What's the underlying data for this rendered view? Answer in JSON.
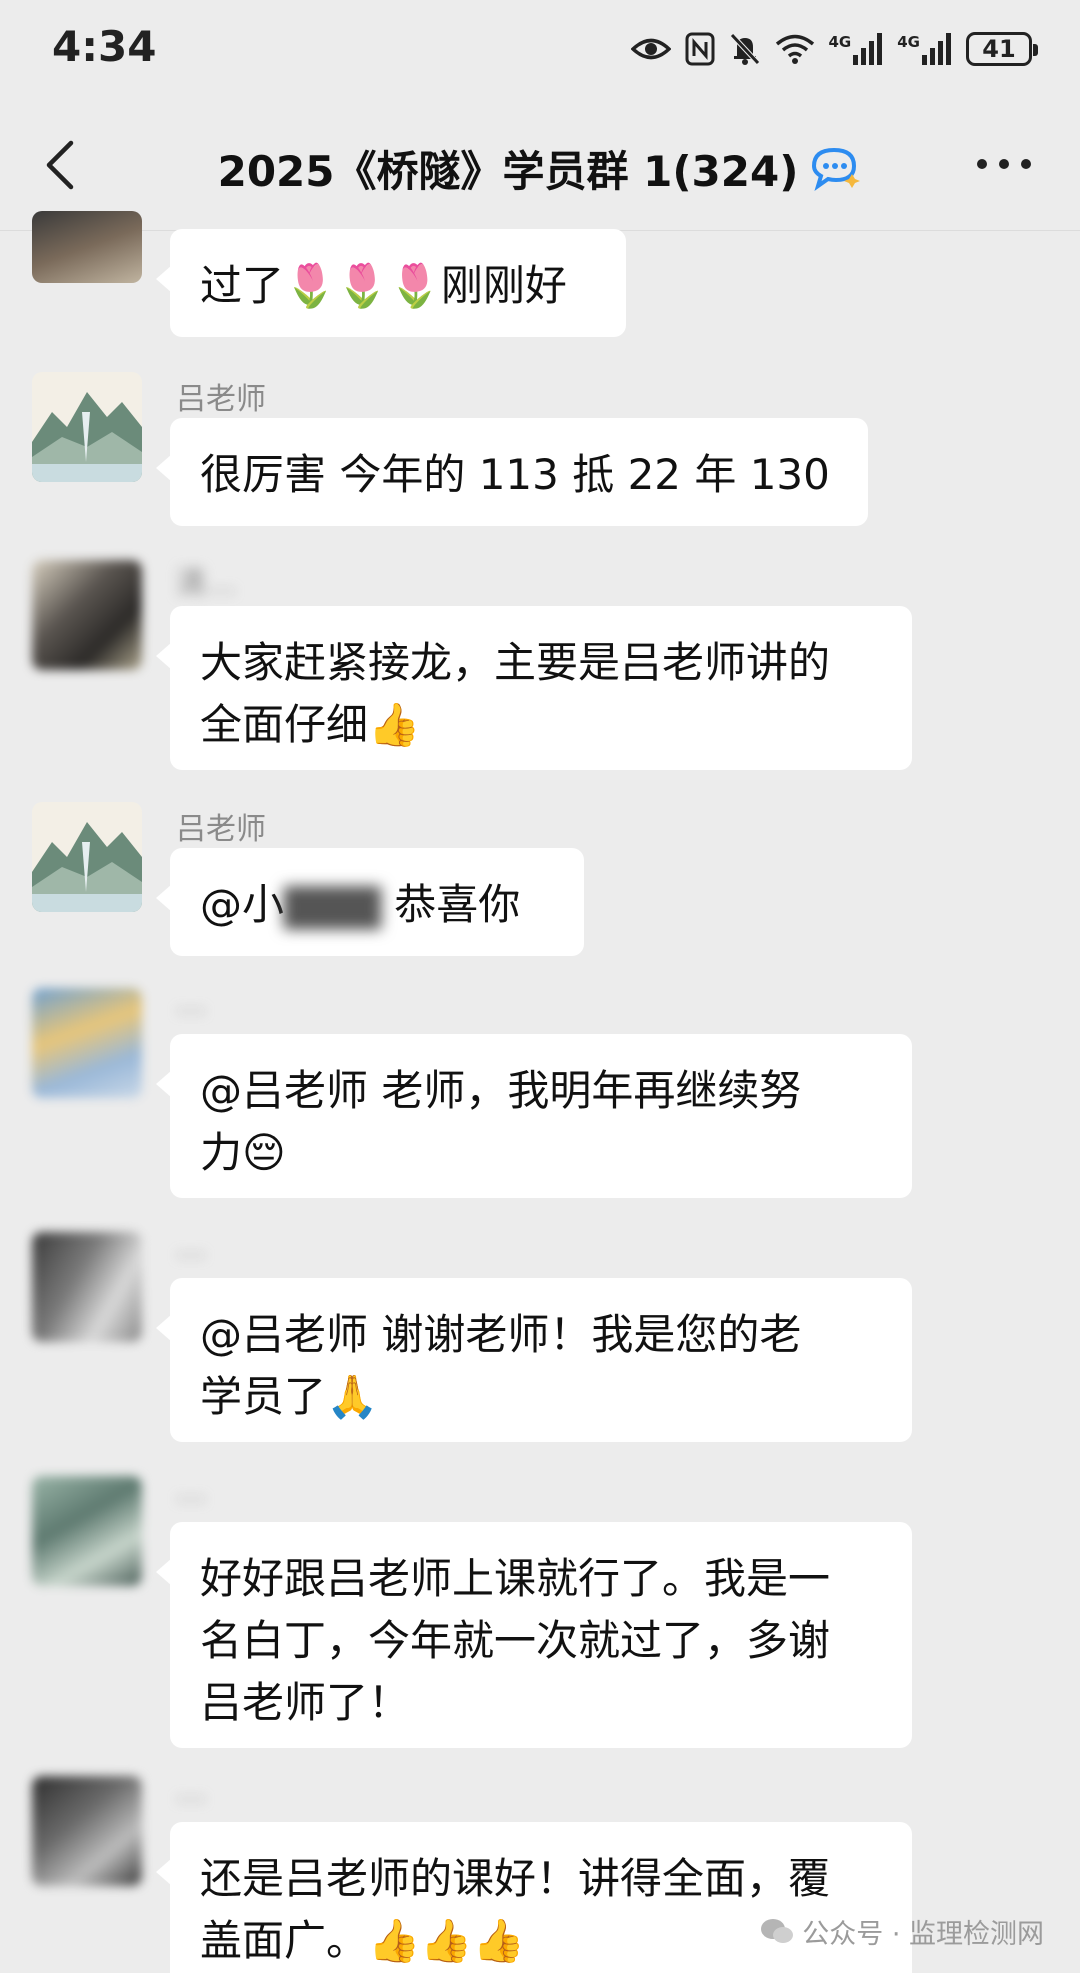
{
  "status_bar": {
    "time": "4:34",
    "network_1": "4G",
    "network_2": "4G",
    "battery": "41"
  },
  "header": {
    "title": "2025《桥隧》学员群 1(324)"
  },
  "messages": [
    {
      "sender": "",
      "text": "过了🌷🌷🌷刚刚好"
    },
    {
      "sender": "吕老师",
      "text": "很厉害 今年的 113 抵 22 年 130"
    },
    {
      "sender": "清…",
      "text_line1": "大家赶紧接龙，主要是吕老师讲的",
      "text_line2": "全面仔细👍"
    },
    {
      "sender": "吕老师",
      "text_prefix": "@小",
      "text_suffix": "恭喜你"
    },
    {
      "sender": "…",
      "text_line1": "@吕老师  老师，我明年再继续努",
      "text_line2": "力😔"
    },
    {
      "sender": "…",
      "text_line1": "@吕老师  谢谢老师！我是您的老",
      "text_line2": "学员了🙏"
    },
    {
      "sender": "…",
      "text_line1": "好好跟吕老师上课就行了。我是一",
      "text_line2": "名白丁，今年就一次就过了，多谢",
      "text_line3": "吕老师了！"
    },
    {
      "sender": "…",
      "text_line1": "还是吕老师的课好！讲得全面，覆",
      "text_line2": "盖面广。👍👍👍"
    }
  ],
  "watermark": "公众号 · 监理检测网",
  "colors": {
    "background": "#ececec",
    "bubble": "#ffffff",
    "sender_name": "#8a8a8a"
  }
}
